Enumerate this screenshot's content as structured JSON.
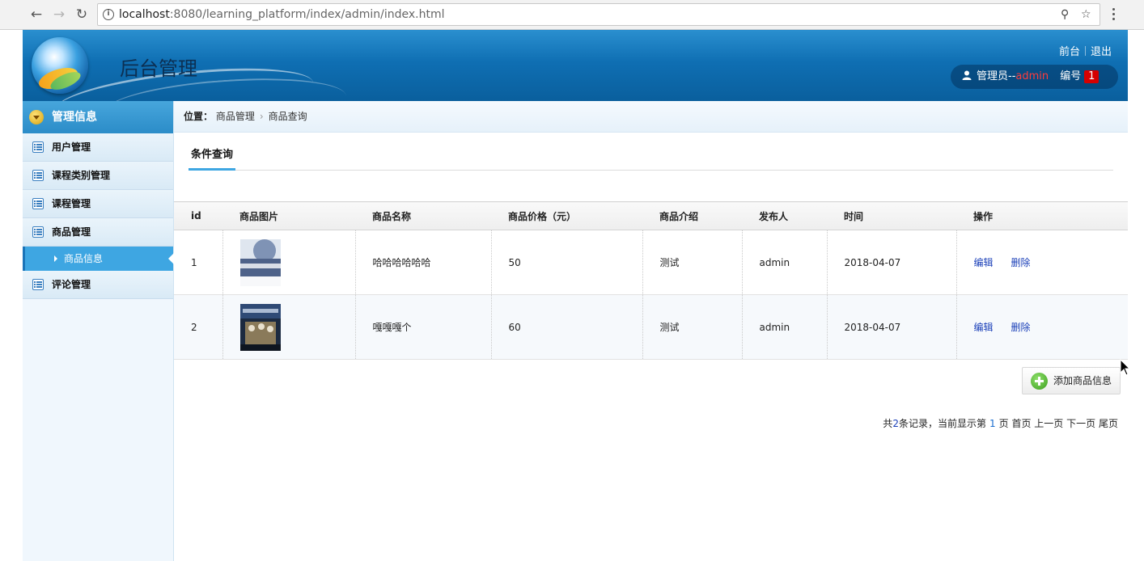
{
  "browser": {
    "url_host": "localhost",
    "url_rest": ":8080/learning_platform/index/admin/index.html"
  },
  "header": {
    "title": "后台管理",
    "links": {
      "front": "前台",
      "logout": "退出"
    },
    "user": {
      "label": "管理员--",
      "name": "admin",
      "id_label": "编号",
      "id_value": "1"
    }
  },
  "sidebar": {
    "heading": "管理信息",
    "items": [
      {
        "label": "用户管理"
      },
      {
        "label": "课程类别管理"
      },
      {
        "label": "课程管理"
      },
      {
        "label": "商品管理"
      },
      {
        "label": "评论管理"
      }
    ],
    "sub_item": {
      "label": "商品信息"
    }
  },
  "breadcrumb": {
    "prefix": "位置：",
    "level1": "商品管理",
    "level2": "商品查询"
  },
  "tab": {
    "label": "条件查询"
  },
  "table": {
    "headers": [
      "id",
      "商品图片",
      "商品名称",
      "商品价格（元）",
      "商品介绍",
      "发布人",
      "时间",
      "操作"
    ],
    "rows": [
      {
        "id": "1",
        "name": "哈哈哈哈哈哈",
        "price": "50",
        "intro": "测试",
        "publisher": "admin",
        "time": "2018-04-07",
        "edit": "编辑",
        "delete": "删除"
      },
      {
        "id": "2",
        "name": "嘎嘎嘎个",
        "price": "60",
        "intro": "测试",
        "publisher": "admin",
        "time": "2018-04-07",
        "edit": "编辑",
        "delete": "删除"
      }
    ]
  },
  "add_button": {
    "label": "添加商品信息"
  },
  "pager": {
    "total_prefix": "共",
    "total_count": "2",
    "total_suffix": "条记录，当前显示第",
    "current_page": "1",
    "page_suffix": "页",
    "first": "首页",
    "prev": "上一页",
    "next": "下一页",
    "last": "尾页"
  },
  "colors": {
    "accent": "#3ea6e2",
    "header": "#0f6fb3",
    "link": "#1a3fb8",
    "badge": "#d60000"
  }
}
